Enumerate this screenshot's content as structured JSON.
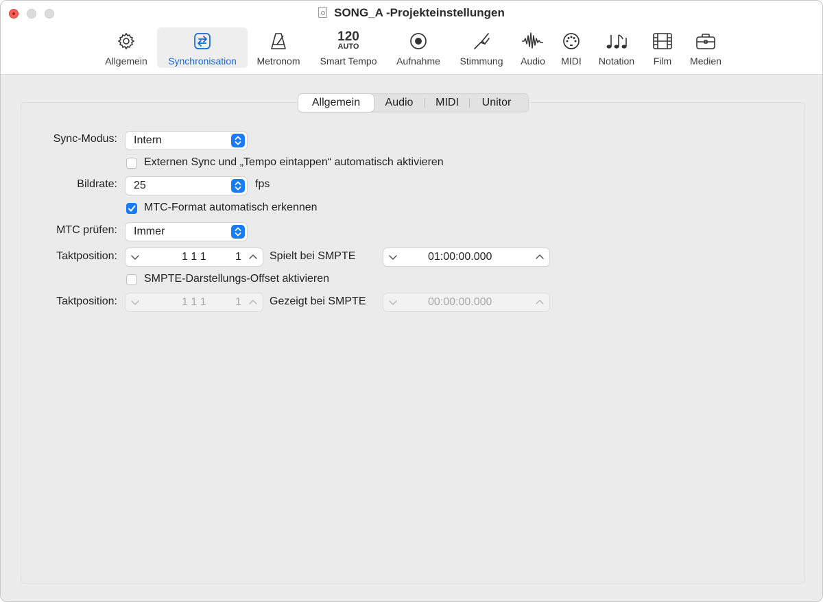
{
  "window": {
    "title": "SONG_A -Projekteinstellungen"
  },
  "toolbar": {
    "items": [
      {
        "label": "Allgemein",
        "icon": "gear-icon"
      },
      {
        "label": "Synchronisation",
        "icon": "sync-arrows-icon",
        "selected": true
      },
      {
        "label": "Metronom",
        "icon": "metronome-icon"
      },
      {
        "label": "Smart Tempo",
        "icon": "smart-tempo-icon",
        "tempo_value": "120",
        "tempo_mode": "AUTO"
      },
      {
        "label": "Aufnahme",
        "icon": "record-icon"
      },
      {
        "label": "Stimmung",
        "icon": "tuning-fork-icon"
      },
      {
        "label": "Audio",
        "icon": "waveform-icon"
      },
      {
        "label": "MIDI",
        "icon": "midi-port-icon"
      },
      {
        "label": "Notation",
        "icon": "music-notes-icon"
      },
      {
        "label": "Film",
        "icon": "film-icon"
      },
      {
        "label": "Medien",
        "icon": "briefcase-icon"
      }
    ]
  },
  "tabs": [
    {
      "label": "Allgemein",
      "active": true
    },
    {
      "label": "Audio"
    },
    {
      "label": "MIDI"
    },
    {
      "label": "Unitor"
    }
  ],
  "form": {
    "sync_mode": {
      "label": "Sync-Modus:",
      "value": "Intern"
    },
    "auto_sync": {
      "label": "Externen Sync und „Tempo eintappen“ automatisch aktivieren",
      "checked": false
    },
    "frame_rate": {
      "label": "Bildrate:",
      "value": "25",
      "unit": "fps"
    },
    "mtc_format": {
      "label": "MTC-Format automatisch erkennen",
      "checked": true
    },
    "mtc_check": {
      "label": "MTC prüfen:",
      "value": "Immer"
    },
    "position1": {
      "label": "Taktposition:",
      "bar": "1 1 1",
      "tick": "1",
      "smpte_label": "Spielt bei SMPTE",
      "smpte_value": "01:00:00.000"
    },
    "offset": {
      "label": "SMPTE-Darstellungs-Offset aktivieren",
      "checked": false
    },
    "position2": {
      "label": "Taktposition:",
      "bar": "1 1 1",
      "tick": "1",
      "smpte_label": "Gezeigt bei SMPTE",
      "smpte_value": "00:00:00.000"
    }
  },
  "colors": {
    "accent": "#1a7cf5",
    "selected_text": "#1467d6",
    "close_button": "#ff5f57"
  }
}
